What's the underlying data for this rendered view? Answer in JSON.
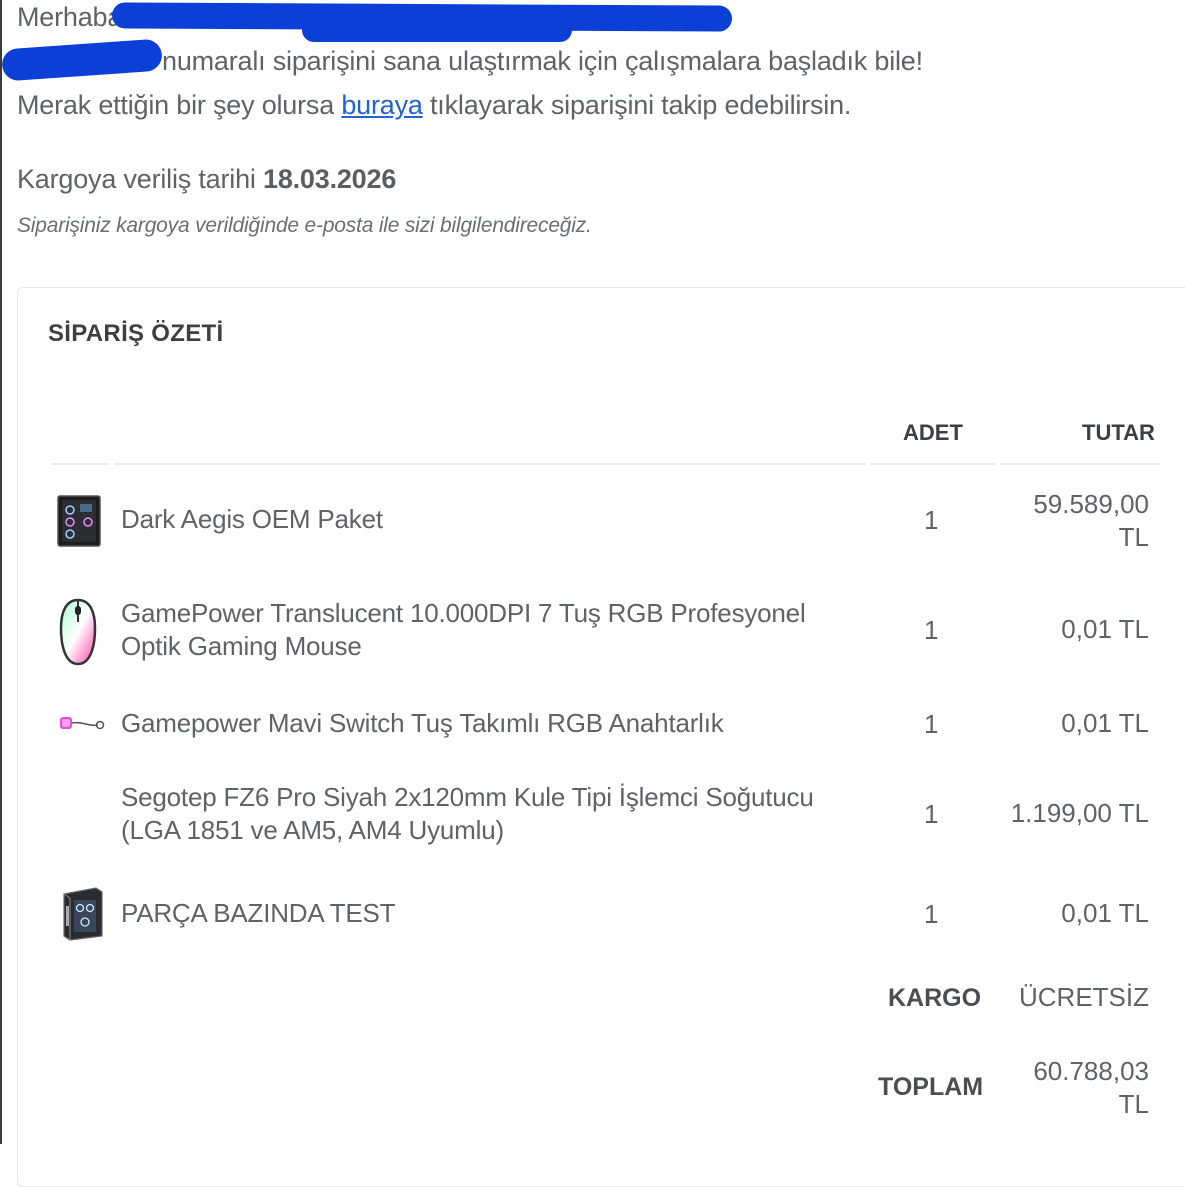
{
  "greeting": {
    "line1": "Merhaba",
    "line2": "numaralı siparişini sana ulaştırmak için çalışmalara başladık bile!",
    "line3_before": "Merak ettiğin bir şey olursa ",
    "line3_link": "buraya",
    "line3_after": " tıklayarak siparişini takip edebilirsin."
  },
  "shipping": {
    "label": "Kargoya veriliş tarihi ",
    "date": "18.03.2026",
    "note": "Siparişiniz kargoya verildiğinde e-posta ile sizi bilgilendireceğiz."
  },
  "summary": {
    "title": "SİPARİŞ ÖZETİ",
    "col_qty": "ADET",
    "col_amount": "TUTAR",
    "items": [
      {
        "name": "Dark Aegis OEM Paket",
        "qty": "1",
        "amount_l1": "59.589,00",
        "amount_l2": "TL",
        "icon": "pc-case-icon"
      },
      {
        "name_l1": "GamePower Translucent 10.000DPI 7 Tuş RGB Profesyonel",
        "name_l2": "Optik Gaming Mouse",
        "qty": "1",
        "amount": "0,01 TL",
        "icon": "mouse-icon"
      },
      {
        "name": "Gamepower Mavi Switch Tuş Takımlı RGB Anahtarlık",
        "qty": "1",
        "amount": "0,01 TL",
        "icon": "keychain-icon"
      },
      {
        "name_l1": "Segotep FZ6 Pro Siyah 2x120mm Kule Tipi İşlemci Soğutucu",
        "name_l2": "(LGA 1851 ve AM5, AM4 Uyumlu)",
        "qty": "1",
        "amount": "1.199,00 TL"
      },
      {
        "name": "PARÇA BAZINDA TEST",
        "qty": "1",
        "amount": "0,01 TL",
        "icon": "pc-case-icon"
      }
    ],
    "shipping_label": "KARGO",
    "shipping_value": "ÜCRETSİZ",
    "total_label": "TOPLAM",
    "total_l1": "60.788,03",
    "total_l2": "TL"
  },
  "colors": {
    "link": "#2563c9",
    "redaction": "#0b3fd6",
    "text": "#5f6368"
  }
}
